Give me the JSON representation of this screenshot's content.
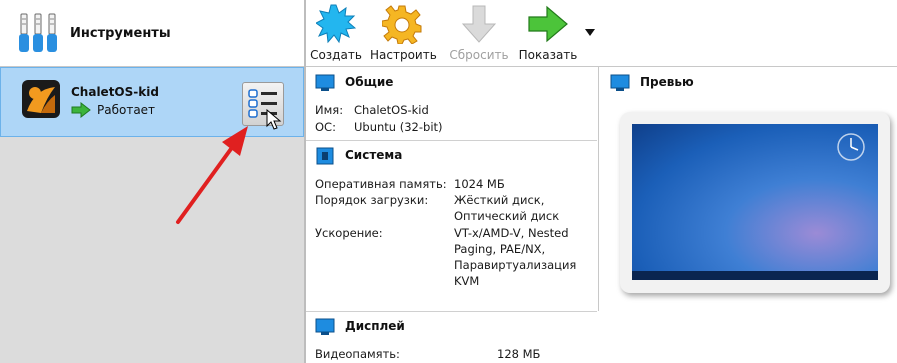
{
  "tools": {
    "label": "Инструменты"
  },
  "vm": {
    "name": "ChaletOS-kid",
    "state": "Работает"
  },
  "toolbar": {
    "create": "Создать",
    "settings": "Настроить",
    "discard": "Сбросить",
    "show": "Показать"
  },
  "general": {
    "title": "Общие",
    "name_label": "Имя:",
    "name_value": "ChaletOS-kid",
    "os_label": "ОС:",
    "os_value": "Ubuntu (32-bit)"
  },
  "system": {
    "title": "Система",
    "ram_label": "Оперативная память:",
    "ram_value": "1024 МБ",
    "boot_label": "Порядок загрузки:",
    "boot_value_1": "Жёсткий диск,",
    "boot_value_2": "Оптический диск",
    "accel_label": "Ускорение:",
    "accel_value_1": "VT-x/AMD-V, Nested",
    "accel_value_2": "Paging, PAE/NX,",
    "accel_value_3": "Паравиртуализация",
    "accel_value_4": "KVM"
  },
  "display": {
    "title": "Дисплей",
    "vram_label": "Видеопамять:",
    "vram_value": "128 МБ"
  },
  "preview": {
    "title": "Превью"
  },
  "colors": {
    "selection_bg": "#aed6f7",
    "selection_border": "#6cb2ea",
    "left_bg": "#dcdcdc",
    "annotation_arrow": "#e02020"
  },
  "icons": [
    "tools-icon",
    "os-icon",
    "running-arrow-icon",
    "vm-menu-icon",
    "cursor-icon",
    "create-icon",
    "settings-icon",
    "discard-icon",
    "show-icon",
    "dropdown-arrow-icon",
    "monitor-icon",
    "chip-icon"
  ]
}
